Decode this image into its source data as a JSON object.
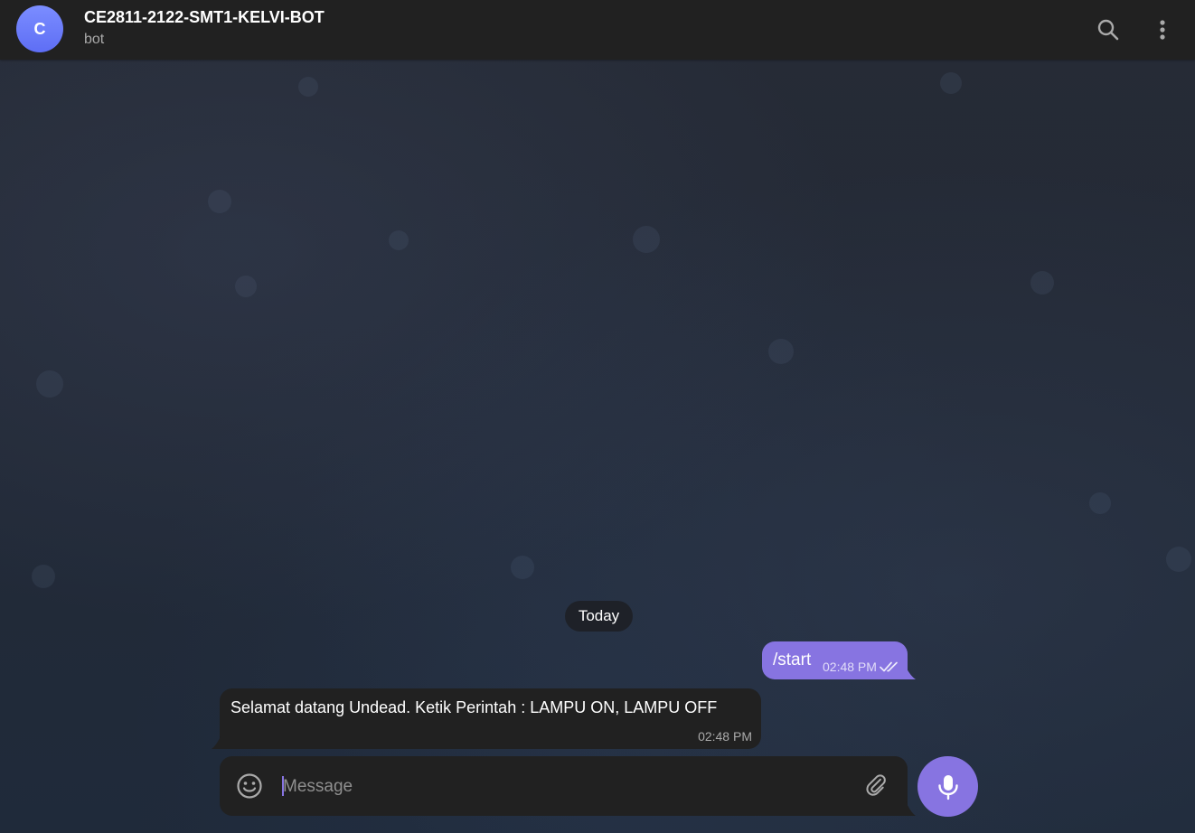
{
  "header": {
    "avatar_letter": "C",
    "title": "CE2811-2122-SMT1-KELVI-BOT",
    "subtitle": "bot",
    "search_icon": "search-icon",
    "menu_icon": "more-vertical-icon"
  },
  "chat": {
    "date_label": "Today",
    "messages": [
      {
        "direction": "outgoing",
        "text": "/start",
        "time": "02:48 PM",
        "status_icon": "double-check-icon"
      },
      {
        "direction": "incoming",
        "text": "Selamat datang Undead. Ketik Perintah : LAMPU ON, LAMPU OFF",
        "time": "02:48 PM"
      }
    ]
  },
  "composer": {
    "placeholder": "Message",
    "value": "",
    "emoji_icon": "smile-icon",
    "attach_icon": "paperclip-icon",
    "send_icon": "microphone-icon"
  },
  "colors": {
    "accent": "#8774e1",
    "header_bg": "#212121",
    "bubble_incoming": "#212121"
  }
}
